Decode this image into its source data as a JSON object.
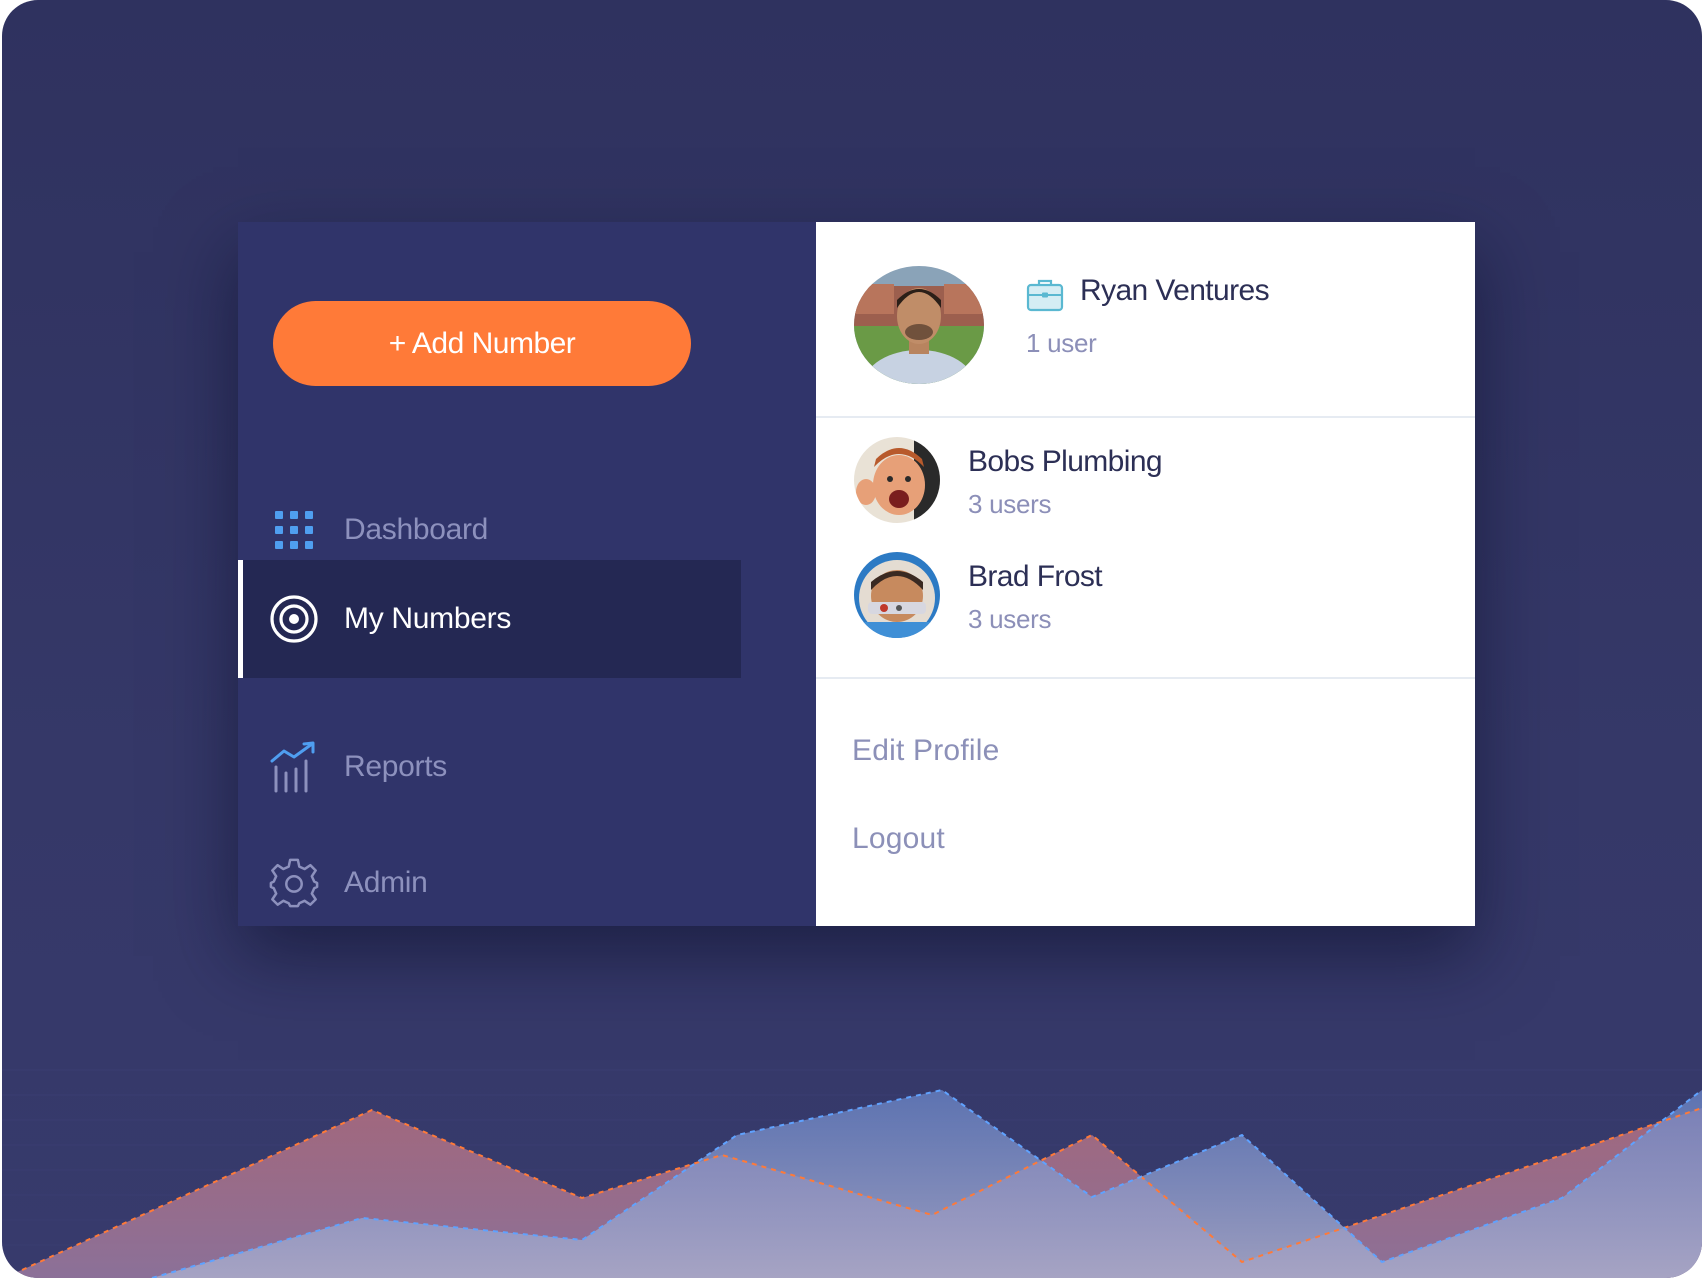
{
  "sidebar": {
    "add_button_label": "+ Add Number",
    "items": [
      {
        "label": "Dashboard",
        "icon": "grid-icon",
        "active": false
      },
      {
        "label": "My Numbers",
        "icon": "target-icon",
        "active": true
      },
      {
        "label": "Reports",
        "icon": "chart-trend-icon",
        "active": false
      },
      {
        "label": "Admin",
        "icon": "gear-icon",
        "active": false
      }
    ]
  },
  "account_menu": {
    "current_account": {
      "name": "Ryan Ventures",
      "users": "1 user",
      "icon": "briefcase-icon"
    },
    "other_accounts": [
      {
        "name": "Bobs Plumbing",
        "users": "3 users"
      },
      {
        "name": "Brad Frost",
        "users": "3 users"
      }
    ],
    "links": [
      {
        "label": "Edit Profile"
      },
      {
        "label": "Logout"
      }
    ]
  },
  "colors": {
    "background": "#323564",
    "sidebar": "#30346a",
    "sidebar_active": "#242853",
    "accent_orange": "#ff7a38",
    "icon_blue": "#4f9ef0",
    "panel": "#ffffff",
    "text_dark": "#2c2f55",
    "text_muted": "#8c8fb8"
  }
}
